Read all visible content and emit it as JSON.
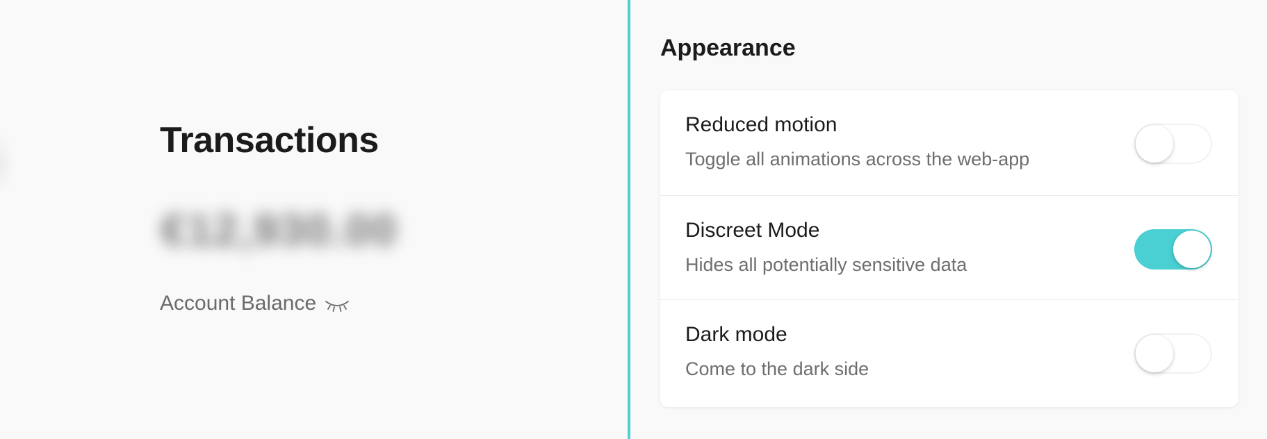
{
  "left": {
    "title": "Transactions",
    "balance_value": "€12,930.00",
    "balance_label": "Account Balance",
    "balance_icon": "closed-eye-icon"
  },
  "appearance": {
    "title": "Appearance",
    "settings": [
      {
        "title": "Reduced motion",
        "description": "Toggle all animations across the web-app",
        "enabled": false
      },
      {
        "title": "Discreet Mode",
        "description": "Hides all potentially sensitive data",
        "enabled": true
      },
      {
        "title": "Dark mode",
        "description": "Come to the dark side",
        "enabled": false
      }
    ]
  },
  "colors": {
    "accent": "#4acfd2",
    "divider": "#4ecfd3"
  }
}
